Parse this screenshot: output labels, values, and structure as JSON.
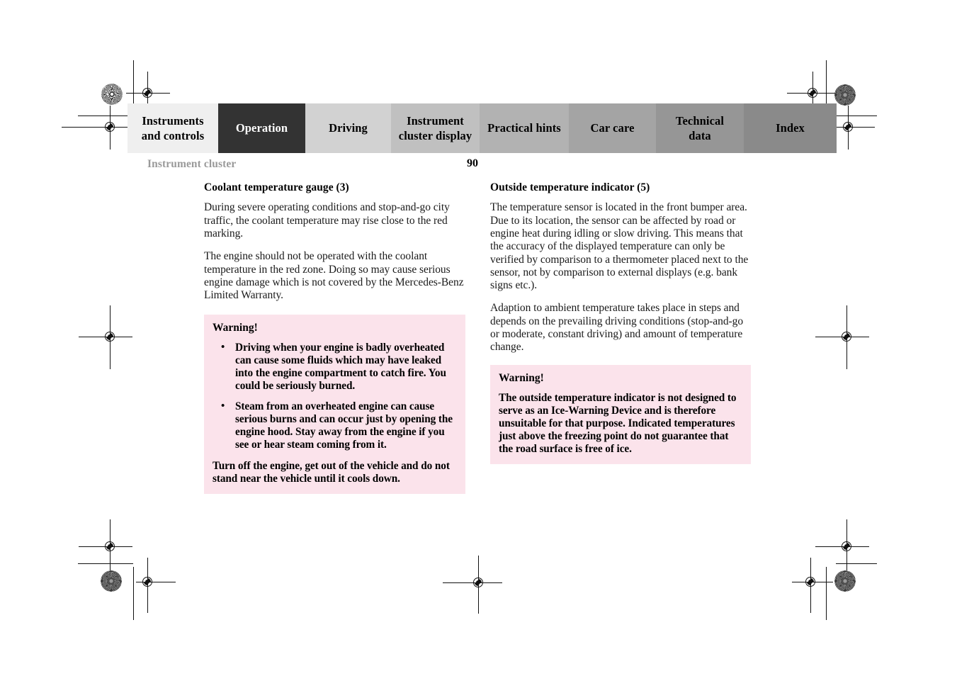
{
  "document": {
    "running_head": "Instrument cluster",
    "page_number": "90"
  },
  "tabbar": {
    "tabs": [
      {
        "label": "Instruments and controls",
        "label_lines": [
          "Instruments",
          "and controls"
        ],
        "bg": "#efefef",
        "active": false
      },
      {
        "label": "Operation",
        "label_lines": [
          "Operation"
        ],
        "bg": "#333333",
        "active": true
      },
      {
        "label": "Driving",
        "label_lines": [
          "Driving"
        ],
        "bg": "#d2d2d2",
        "active": false
      },
      {
        "label": "Instrument cluster display",
        "label_lines": [
          "Instrument",
          "cluster display"
        ],
        "bg": "#c0c0c0",
        "active": false
      },
      {
        "label": "Practical hints",
        "label_lines": [
          "Practical hints"
        ],
        "bg": "#b2b2b2",
        "active": false
      },
      {
        "label": "Car care",
        "label_lines": [
          "Car care"
        ],
        "bg": "#a4a4a4",
        "active": false
      },
      {
        "label": "Technical data",
        "label_lines": [
          "Technical",
          "data"
        ],
        "bg": "#969696",
        "active": false
      },
      {
        "label": "Index",
        "label_lines": [
          "Index"
        ],
        "bg": "#8a8a8a",
        "active": false
      }
    ]
  },
  "left_column": {
    "heading": "Coolant temperature gauge (3)",
    "paragraphs": [
      "During severe operating conditions and stop-and-go city traffic, the coolant temperature may rise close to the red marking.",
      "The engine should not be operated with the coolant temperature in the red zone. Doing so may cause serious engine damage which is not covered by the Mercedes-Benz Limited Warranty."
    ],
    "warning": {
      "title": "Warning!",
      "bullet_marker": "•",
      "bullets": [
        "Driving when your engine is badly overheated can cause some fluids which may have leaked into the engine compartment to catch fire. You could be seriously burned.",
        "Steam from an overheated engine can cause serious burns and can occur just by opening the engine hood. Stay away from the engine if you see or hear steam coming from it."
      ],
      "tail": "Turn off the engine, get out of the vehicle and do not stand near the vehicle until it cools down."
    }
  },
  "right_column": {
    "heading": "Outside temperature indicator (5)",
    "paragraphs": [
      "The temperature sensor is located in the front bumper area. Due to its location, the sensor can be affected by road or engine heat during idling or slow driving. This means that the accuracy of the displayed temperature can only be verified by comparison to a thermometer placed next to the sensor, not by comparison to external displays (e.g. bank signs etc.).",
      "Adaption to ambient temperature takes place in steps and depends on the prevailing driving conditions (stop-and-go or moderate, constant driving) and amount of temperature change."
    ],
    "warning": {
      "title": "Warning!",
      "body": "The outside temperature indicator is not designed to serve as an Ice-Warning Device and is therefore unsuitable for that purpose. Indicated temperatures just above the freezing point do not guarantee that the road surface is free of ice."
    }
  },
  "print_marks": {
    "warning_bg": "#fbe3eb",
    "mark_color": "#111111",
    "running_head_color": "#9a9a9a"
  }
}
